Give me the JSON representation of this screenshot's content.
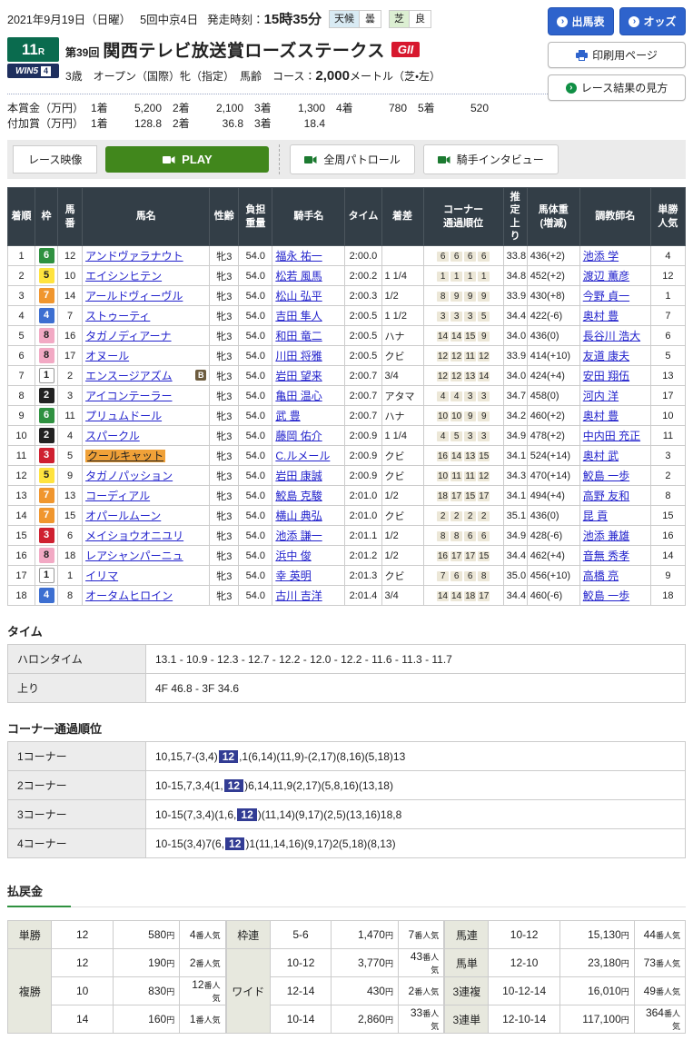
{
  "header": {
    "date": "2021年9月19日（日曜）",
    "meeting": "5回中京4日",
    "start_label": "発走時刻：",
    "start_time": "15時35分",
    "weather_label": "天候",
    "weather_value": "曇",
    "turf_label": "芝",
    "turf_value": "良",
    "btn_racecard": "出馬表",
    "btn_odds": "オッズ",
    "btn_print": "印刷用ページ",
    "btn_guide": "レース結果の見方"
  },
  "race": {
    "race_no": "11",
    "race_no_suffix": "R",
    "win5_logo": "WIN5",
    "win5_num": "4",
    "edition": "第39回",
    "title": "関西テレビ放送賞ローズステークス",
    "grade": "GII",
    "conditions": "3歳　オープン（国際）牝（指定）　馬齢",
    "course_label": "コース：",
    "course_value": "2,000",
    "course_unit": "メートル（芝・左）"
  },
  "prize": {
    "main_label": "本賞金（万円）",
    "main_items": [
      {
        "k": "1着",
        "v": "5,200"
      },
      {
        "k": "2着",
        "v": "2,100"
      },
      {
        "k": "3着",
        "v": "1,300"
      },
      {
        "k": "4着",
        "v": "780"
      },
      {
        "k": "5着",
        "v": "520"
      }
    ],
    "extra_label": "付加賞（万円）",
    "extra_items": [
      {
        "k": "1着",
        "v": "128.8"
      },
      {
        "k": "2着",
        "v": "36.8"
      },
      {
        "k": "3着",
        "v": "18.4"
      }
    ]
  },
  "video": {
    "label": "レース映像",
    "play": "PLAY",
    "patrol": "全周パトロール",
    "interview": "騎手インタビュー"
  },
  "results": {
    "headers": [
      [
        "着順"
      ],
      [
        "枠"
      ],
      [
        "馬",
        "番"
      ],
      [
        "馬名"
      ],
      [
        "性齢"
      ],
      [
        "負担",
        "重量"
      ],
      [
        "騎手名"
      ],
      [
        "タイム"
      ],
      [
        "着差"
      ],
      [
        "コーナー",
        "通過順位"
      ],
      [
        "推",
        "定",
        "上",
        "り"
      ],
      [
        "馬体重",
        "(増減)"
      ],
      [
        "調教師名"
      ],
      [
        "単勝",
        "人気"
      ]
    ],
    "rows": [
      {
        "pos": 1,
        "frame": 6,
        "num": 12,
        "name": "アンドヴァラナウト",
        "blinker": false,
        "highlight": false,
        "sex_age": "牝3",
        "weight": "54.0",
        "jockey": "福永 祐一",
        "time": "2:00.0",
        "margin": "",
        "corners": [
          6,
          6,
          6,
          6
        ],
        "last3f": "33.8",
        "body_weight": "436(+2)",
        "trainer": "池添 学",
        "pop": 4
      },
      {
        "pos": 2,
        "frame": 5,
        "num": 10,
        "name": "エイシンヒテン",
        "blinker": false,
        "highlight": false,
        "sex_age": "牝3",
        "weight": "54.0",
        "jockey": "松若 風馬",
        "time": "2:00.2",
        "margin": "1 1/4",
        "corners": [
          1,
          1,
          1,
          1
        ],
        "last3f": "34.8",
        "body_weight": "452(+2)",
        "trainer": "渡辺 薫彦",
        "pop": 12
      },
      {
        "pos": 3,
        "frame": 7,
        "num": 14,
        "name": "アールドヴィーヴル",
        "blinker": false,
        "highlight": false,
        "sex_age": "牝3",
        "weight": "54.0",
        "jockey": "松山 弘平",
        "time": "2:00.3",
        "margin": "1/2",
        "corners": [
          8,
          9,
          9,
          9
        ],
        "last3f": "33.9",
        "body_weight": "430(+8)",
        "trainer": "今野 貞一",
        "pop": 1
      },
      {
        "pos": 4,
        "frame": 4,
        "num": 7,
        "name": "ストゥーティ",
        "blinker": false,
        "highlight": false,
        "sex_age": "牝3",
        "weight": "54.0",
        "jockey": "吉田 隼人",
        "time": "2:00.5",
        "margin": "1 1/2",
        "corners": [
          3,
          3,
          3,
          5
        ],
        "last3f": "34.4",
        "body_weight": "422(-6)",
        "trainer": "奥村 豊",
        "pop": 7
      },
      {
        "pos": 5,
        "frame": 8,
        "num": 16,
        "name": "タガノディアーナ",
        "blinker": false,
        "highlight": false,
        "sex_age": "牝3",
        "weight": "54.0",
        "jockey": "和田 竜二",
        "time": "2:00.5",
        "margin": "ハナ",
        "corners": [
          14,
          14,
          15,
          9
        ],
        "last3f": "34.0",
        "body_weight": "436(0)",
        "trainer": "長谷川 浩大",
        "pop": 6
      },
      {
        "pos": 6,
        "frame": 8,
        "num": 17,
        "name": "オヌール",
        "blinker": false,
        "highlight": false,
        "sex_age": "牝3",
        "weight": "54.0",
        "jockey": "川田 将雅",
        "time": "2:00.5",
        "margin": "クビ",
        "corners": [
          12,
          12,
          11,
          12
        ],
        "last3f": "33.9",
        "body_weight": "414(+10)",
        "trainer": "友道 康夫",
        "pop": 5
      },
      {
        "pos": 7,
        "frame": 1,
        "num": 2,
        "name": "エンスージアズム",
        "blinker": true,
        "highlight": false,
        "sex_age": "牝3",
        "weight": "54.0",
        "jockey": "岩田 望来",
        "time": "2:00.7",
        "margin": "3/4",
        "corners": [
          12,
          12,
          13,
          14
        ],
        "last3f": "34.0",
        "body_weight": "424(+4)",
        "trainer": "安田 翔伍",
        "pop": 13
      },
      {
        "pos": 8,
        "frame": 2,
        "num": 3,
        "name": "アイコンテーラー",
        "blinker": false,
        "highlight": false,
        "sex_age": "牝3",
        "weight": "54.0",
        "jockey": "亀田 温心",
        "time": "2:00.7",
        "margin": "アタマ",
        "corners": [
          4,
          4,
          3,
          3
        ],
        "last3f": "34.7",
        "body_weight": "458(0)",
        "trainer": "河内 洋",
        "pop": 17
      },
      {
        "pos": 9,
        "frame": 6,
        "num": 11,
        "name": "プリュムドール",
        "blinker": false,
        "highlight": false,
        "sex_age": "牝3",
        "weight": "54.0",
        "jockey": "武 豊",
        "time": "2:00.7",
        "margin": "ハナ",
        "corners": [
          10,
          10,
          9,
          9
        ],
        "last3f": "34.2",
        "body_weight": "460(+2)",
        "trainer": "奥村 豊",
        "pop": 10
      },
      {
        "pos": 10,
        "frame": 2,
        "num": 4,
        "name": "スパークル",
        "blinker": false,
        "highlight": false,
        "sex_age": "牝3",
        "weight": "54.0",
        "jockey": "藤岡 佑介",
        "time": "2:00.9",
        "margin": "1 1/4",
        "corners": [
          4,
          5,
          3,
          3
        ],
        "last3f": "34.9",
        "body_weight": "478(+2)",
        "trainer": "中内田 充正",
        "pop": 11
      },
      {
        "pos": 11,
        "frame": 3,
        "num": 5,
        "name": "クールキャット",
        "blinker": false,
        "highlight": true,
        "sex_age": "牝3",
        "weight": "54.0",
        "jockey": "C.ルメール",
        "time": "2:00.9",
        "margin": "クビ",
        "corners": [
          16,
          14,
          13,
          15
        ],
        "last3f": "34.1",
        "body_weight": "524(+14)",
        "trainer": "奥村 武",
        "pop": 3
      },
      {
        "pos": 12,
        "frame": 5,
        "num": 9,
        "name": "タガノパッション",
        "blinker": false,
        "highlight": false,
        "sex_age": "牝3",
        "weight": "54.0",
        "jockey": "岩田 康誠",
        "time": "2:00.9",
        "margin": "クビ",
        "corners": [
          10,
          11,
          11,
          12
        ],
        "last3f": "34.3",
        "body_weight": "470(+14)",
        "trainer": "鮫島 一歩",
        "pop": 2
      },
      {
        "pos": 13,
        "frame": 7,
        "num": 13,
        "name": "コーディアル",
        "blinker": false,
        "highlight": false,
        "sex_age": "牝3",
        "weight": "54.0",
        "jockey": "鮫島 克駿",
        "time": "2:01.0",
        "margin": "1/2",
        "corners": [
          18,
          17,
          15,
          17
        ],
        "last3f": "34.1",
        "body_weight": "494(+4)",
        "trainer": "高野 友和",
        "pop": 8
      },
      {
        "pos": 14,
        "frame": 7,
        "num": 15,
        "name": "オパールムーン",
        "blinker": false,
        "highlight": false,
        "sex_age": "牝3",
        "weight": "54.0",
        "jockey": "横山 典弘",
        "time": "2:01.0",
        "margin": "クビ",
        "corners": [
          2,
          2,
          2,
          2
        ],
        "last3f": "35.1",
        "body_weight": "436(0)",
        "trainer": "昆 貢",
        "pop": 15
      },
      {
        "pos": 15,
        "frame": 3,
        "num": 6,
        "name": "メイショウオニユリ",
        "blinker": false,
        "highlight": false,
        "sex_age": "牝3",
        "weight": "54.0",
        "jockey": "池添 謙一",
        "time": "2:01.1",
        "margin": "1/2",
        "corners": [
          8,
          8,
          6,
          6
        ],
        "last3f": "34.9",
        "body_weight": "428(-6)",
        "trainer": "池添 兼雄",
        "pop": 16
      },
      {
        "pos": 16,
        "frame": 8,
        "num": 18,
        "name": "レアシャンパーニュ",
        "blinker": false,
        "highlight": false,
        "sex_age": "牝3",
        "weight": "54.0",
        "jockey": "浜中 俊",
        "time": "2:01.2",
        "margin": "1/2",
        "corners": [
          16,
          17,
          17,
          15
        ],
        "last3f": "34.4",
        "body_weight": "462(+4)",
        "trainer": "音無 秀孝",
        "pop": 14
      },
      {
        "pos": 17,
        "frame": 1,
        "num": 1,
        "name": "イリマ",
        "blinker": false,
        "highlight": false,
        "sex_age": "牝3",
        "weight": "54.0",
        "jockey": "幸 英明",
        "time": "2:01.3",
        "margin": "クビ",
        "corners": [
          7,
          6,
          6,
          8
        ],
        "last3f": "35.0",
        "body_weight": "456(+10)",
        "trainer": "高橋 亮",
        "pop": 9
      },
      {
        "pos": 18,
        "frame": 4,
        "num": 8,
        "name": "オータムヒロイン",
        "blinker": false,
        "highlight": false,
        "sex_age": "牝3",
        "weight": "54.0",
        "jockey": "古川 吉洋",
        "time": "2:01.4",
        "margin": "3/4",
        "corners": [
          14,
          14,
          18,
          17
        ],
        "last3f": "34.4",
        "body_weight": "460(-6)",
        "trainer": "鮫島 一歩",
        "pop": 18
      }
    ]
  },
  "time_section": {
    "heading": "タイム",
    "rows": [
      {
        "label": "ハロンタイム",
        "value": "13.1 - 10.9 - 12.3 - 12.7 - 12.2 - 12.0 - 12.2 - 11.6 - 11.3 - 11.7"
      },
      {
        "label": "上り",
        "value": "4F 46.8 - 3F 34.6"
      }
    ]
  },
  "corner_section": {
    "heading": "コーナー通過順位",
    "rows": [
      {
        "label": "1コーナー",
        "pre": "10,15,7-(3,4)",
        "hl": "12",
        "post": ",1(6,14)(11,9)-(2,17)(8,16)(5,18)13"
      },
      {
        "label": "2コーナー",
        "pre": "10-15,7,3,4(1,",
        "hl": "12",
        "post": ")6,14,11,9(2,17)(5,8,16)(13,18)"
      },
      {
        "label": "3コーナー",
        "pre": "10-15(7,3,4)(1,6,",
        "hl": "12",
        "post": ")(11,14)(9,17)(2,5)(13,16)18,8"
      },
      {
        "label": "4コーナー",
        "pre": "10-15(3,4)7(6,",
        "hl": "12",
        "post": ")1(11,14,16)(9,17)2(5,18)(8,13)"
      }
    ]
  },
  "payout": {
    "heading": "払戻金",
    "unit_yen": "円",
    "unit_pop": "番人気",
    "groups": [
      {
        "col": 1,
        "label": "単勝",
        "rows": [
          {
            "sel": "12",
            "amount": "580",
            "pop": "4"
          }
        ]
      },
      {
        "col": 1,
        "label": "複勝",
        "rows": [
          {
            "sel": "12",
            "amount": "190",
            "pop": "2"
          },
          {
            "sel": "10",
            "amount": "830",
            "pop": "12"
          },
          {
            "sel": "14",
            "amount": "160",
            "pop": "1"
          }
        ]
      },
      {
        "col": 2,
        "label": "枠連",
        "rows": [
          {
            "sel": "5-6",
            "amount": "1,470",
            "pop": "7"
          }
        ]
      },
      {
        "col": 2,
        "label": "ワイド",
        "rows": [
          {
            "sel": "10-12",
            "amount": "3,770",
            "pop": "43"
          },
          {
            "sel": "12-14",
            "amount": "430",
            "pop": "2"
          },
          {
            "sel": "10-14",
            "amount": "2,860",
            "pop": "33"
          }
        ]
      },
      {
        "col": 3,
        "label": "馬連",
        "rows": [
          {
            "sel": "10-12",
            "amount": "15,130",
            "pop": "44"
          }
        ]
      },
      {
        "col": 3,
        "label": "馬単",
        "rows": [
          {
            "sel": "12-10",
            "amount": "23,180",
            "pop": "73"
          }
        ]
      },
      {
        "col": 3,
        "label": "3連複",
        "rows": [
          {
            "sel": "10-12-14",
            "amount": "16,010",
            "pop": "49"
          }
        ]
      },
      {
        "col": 3,
        "label": "3連単",
        "rows": [
          {
            "sel": "12-10-14",
            "amount": "117,100",
            "pop": "364"
          }
        ]
      }
    ]
  },
  "colors": {
    "header_dark": "#333e47",
    "race_no_green": "#0a6b4e",
    "grade_red": "#d7182e",
    "button_blue": "#2e63cc",
    "play_green": "#41871c",
    "link_blue": "#2222cc",
    "highlight_orange": "#f0a138",
    "corner_highlight_navy": "#323c94",
    "frame_colors": {
      "1": "#ffffff",
      "2": "#222222",
      "3": "#cf2030",
      "4": "#3d6fd1",
      "5": "#ffe33e",
      "6": "#2f9140",
      "7": "#f0962e",
      "8": "#f2a9c4"
    }
  }
}
